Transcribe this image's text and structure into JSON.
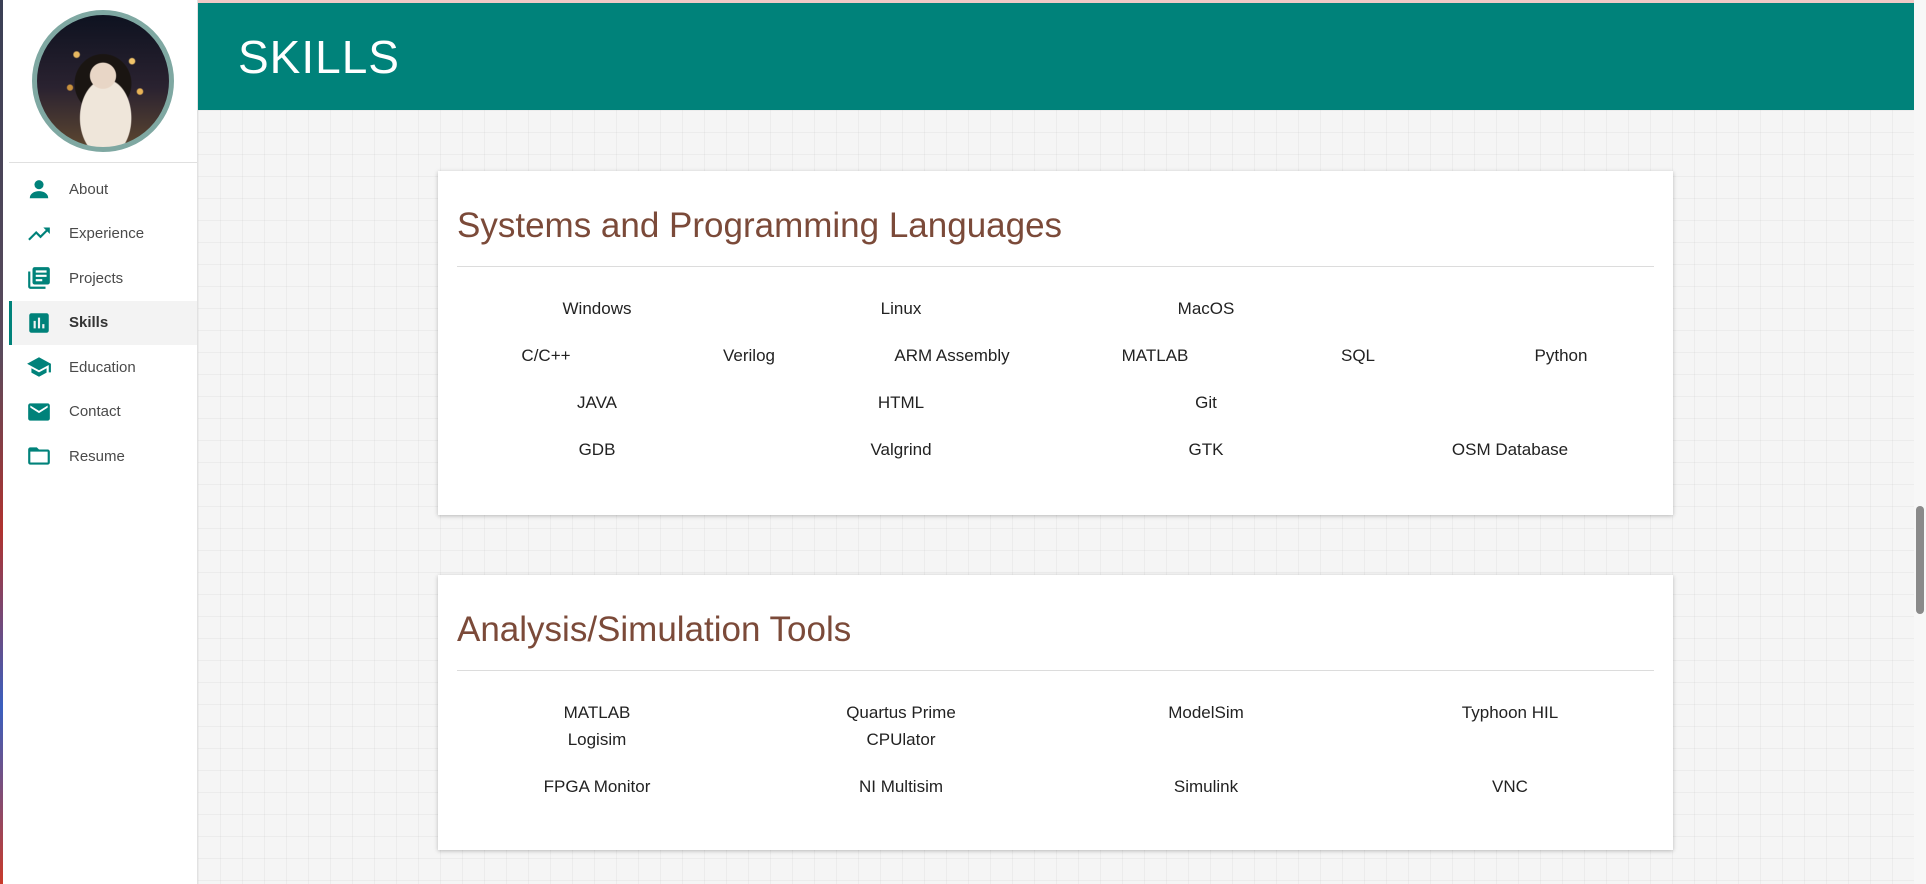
{
  "header": {
    "title": "SKILLS"
  },
  "sidebar": {
    "items": [
      {
        "label": "About",
        "icon": "person-icon",
        "active": false
      },
      {
        "label": "Experience",
        "icon": "trending-up-icon",
        "active": false
      },
      {
        "label": "Projects",
        "icon": "library-books-icon",
        "active": false
      },
      {
        "label": "Skills",
        "icon": "bar-chart-icon",
        "active": true
      },
      {
        "label": "Education",
        "icon": "school-icon",
        "active": false
      },
      {
        "label": "Contact",
        "icon": "mail-icon",
        "active": false
      },
      {
        "label": "Resume",
        "icon": "folder-icon",
        "active": false
      }
    ]
  },
  "sections": [
    {
      "title": "Systems and Programming Languages",
      "rows": [
        [
          "Windows",
          "Linux",
          "MacOS"
        ],
        [
          "C/C++",
          "Verilog",
          "ARM Assembly",
          "MATLAB",
          "SQL",
          "Python"
        ],
        [
          "JAVA",
          "HTML",
          "Git"
        ],
        [
          "GDB",
          "Valgrind",
          "GTK",
          "OSM Database"
        ]
      ]
    },
    {
      "title": "Analysis/Simulation Tools",
      "rows": [
        [
          "MATLAB\nLogisim",
          "Quartus Prime\nCPUlator",
          "ModelSim",
          "Typhoon HIL"
        ],
        [
          "FPGA Monitor",
          "NI Multisim",
          "Simulink",
          "VNC"
        ]
      ]
    }
  ],
  "colors": {
    "primary": "#00827a",
    "section_title": "#7b4a39"
  }
}
